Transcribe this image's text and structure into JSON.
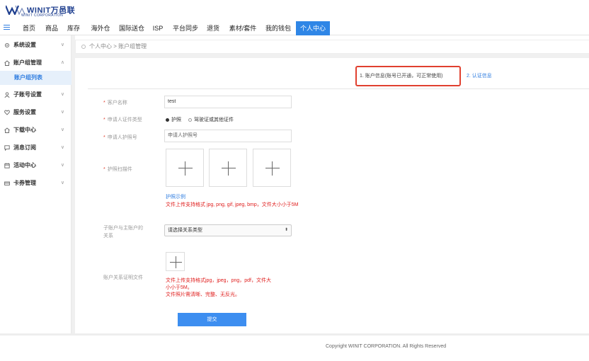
{
  "header": {
    "brand": "WINIT万邑联",
    "brand_sub": "WINIT CORPORATION"
  },
  "nav": {
    "items": [
      "首页",
      "商品",
      "库存",
      "海外仓",
      "国际送仓",
      "ISP",
      "平台同步",
      "退货",
      "素材/套件",
      "我的钱包",
      "个人中心"
    ],
    "active": "个人中心"
  },
  "sidebar": {
    "items": [
      {
        "label": "系统设置",
        "icon": "settings-icon",
        "chevron": "∨"
      },
      {
        "label": "账户组管理",
        "icon": "home-icon",
        "chevron": "∧"
      },
      {
        "label": "子账号设置",
        "icon": "user-icon",
        "chevron": "∨"
      },
      {
        "label": "服务设置",
        "icon": "heart-icon",
        "chevron": "∨"
      },
      {
        "label": "下载中心",
        "icon": "home-icon",
        "chevron": "∨"
      },
      {
        "label": "消息订阅",
        "icon": "message-icon",
        "chevron": "∨"
      },
      {
        "label": "活动中心",
        "icon": "calendar-icon",
        "chevron": "∨"
      },
      {
        "label": "卡券管理",
        "icon": "ticket-icon",
        "chevron": "∨"
      }
    ],
    "sub_item": "账户组列表"
  },
  "breadcrumb": "个人中心 > 账户组管理",
  "steps": {
    "step1": "1. 账户信息(账号已开通，可正常使用)",
    "step2": "2. 认证信息"
  },
  "form": {
    "customer_name_label": "客户名称",
    "customer_name_value": "test",
    "id_type_label": "申请人证件类型",
    "id_type_options": [
      "护照",
      "驾驶证或其他证件"
    ],
    "id_type_selected": "护照",
    "passport_no_label": "申请人护照号",
    "passport_no_placeholder": "申请人护照号",
    "passport_scan_label": "护照扫描件",
    "passport_sample_link": "护照示例",
    "passport_upload_note": "文件上传支持格式 jpg, png, gif, jpeg, bmp，文件大小小于5M",
    "relation_label_line1": "子账户与主账户的",
    "relation_label_line2": "关系",
    "relation_select": "请选择关系类型",
    "proof_label": "账户关系证明文件",
    "proof_note_line1": "文件上传支持格式jpg，jpeg，png，pdf，文件大",
    "proof_note_line2": "小小于5M。",
    "proof_note_line3": "文件照片需清晰、完整、无反光。",
    "submit_label": "提交",
    "required_mark": "*"
  },
  "footer": {
    "copyright": "Copyright WINIT CORPORATION. All Rights Reserved"
  },
  "colors": {
    "accent": "#2f86e6",
    "highlight_border": "#e0402f",
    "error_text": "#e0201f"
  }
}
